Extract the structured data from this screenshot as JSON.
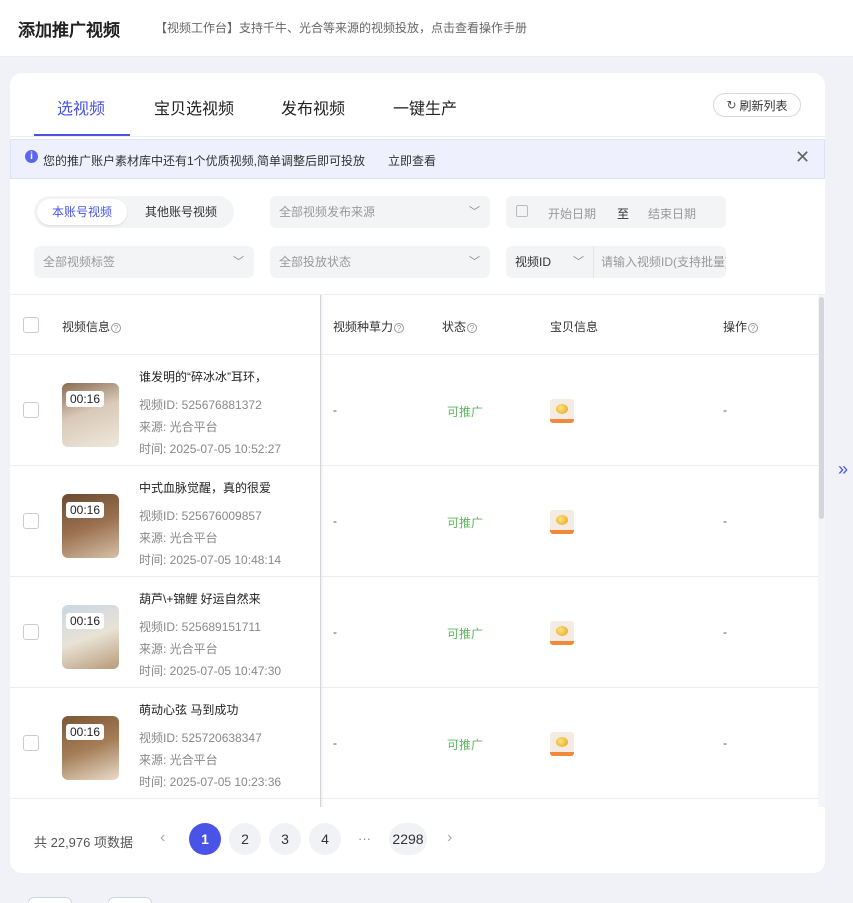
{
  "header": {
    "title": "添加推广视频",
    "subtitle": "【视频工作台】支持千牛、光合等来源的视频投放，点击查看操作手册"
  },
  "tabs": [
    {
      "label": "选视频",
      "active": true
    },
    {
      "label": "宝贝选视频",
      "active": false
    },
    {
      "label": "发布视频",
      "active": false
    },
    {
      "label": "一键生产",
      "active": false
    }
  ],
  "refresh_label": "刷新列表",
  "notice": {
    "text": "您的推广账户素材库中还有1个优质视频,简单调整后即可投放",
    "link": "立即查看"
  },
  "filters": {
    "account_tabs": [
      "本账号视频",
      "其他账号视频"
    ],
    "source_select": "全部视频发布来源",
    "start_date": "开始日期",
    "date_sep": "至",
    "end_date": "结束日期",
    "tag_select": "全部视频标签",
    "status_select": "全部投放状态",
    "id_select": "视频ID",
    "id_placeholder": "请输入视频ID(支持批量)"
  },
  "table": {
    "headers": {
      "video_info": "视频信息",
      "grass_power": "视频种草力",
      "status": "状态",
      "product": "宝贝信息",
      "action": "操作"
    },
    "rows": [
      {
        "duration": "00:16",
        "title": "谁发明的“碎冰冰”耳环，",
        "id": "视频ID: 525676881372",
        "source": "来源: 光合平台",
        "time": "时间: 2025-07-05 10:52:27",
        "grass": "-",
        "status": "可推广",
        "action": "-"
      },
      {
        "duration": "00:16",
        "title": "中式血脉觉醒，真的很爱",
        "id": "视频ID: 525676009857",
        "source": "来源: 光合平台",
        "time": "时间: 2025-07-05 10:48:14",
        "grass": "-",
        "status": "可推广",
        "action": "-"
      },
      {
        "duration": "00:16",
        "title": "葫芦\\+锦鲤 好运自然来",
        "id": "视频ID: 525689151711",
        "source": "来源: 光合平台",
        "time": "时间: 2025-07-05 10:47:30",
        "grass": "-",
        "status": "可推广",
        "action": "-"
      },
      {
        "duration": "00:16",
        "title": "萌动心弦 马到成功",
        "id": "视频ID: 525720638347",
        "source": "来源: 光合平台",
        "time": "时间: 2025-07-05 10:23:36",
        "grass": "-",
        "status": "可推广",
        "action": "-"
      }
    ]
  },
  "pagination": {
    "total": "共 22,976 项数据",
    "pages": [
      "1",
      "2",
      "3",
      "4"
    ],
    "ellipsis": "···",
    "last": "2298",
    "current": "1"
  },
  "colors": {
    "accent": "#4954e6",
    "status_green": "#5cb85c",
    "background": "#f0f2f7"
  }
}
